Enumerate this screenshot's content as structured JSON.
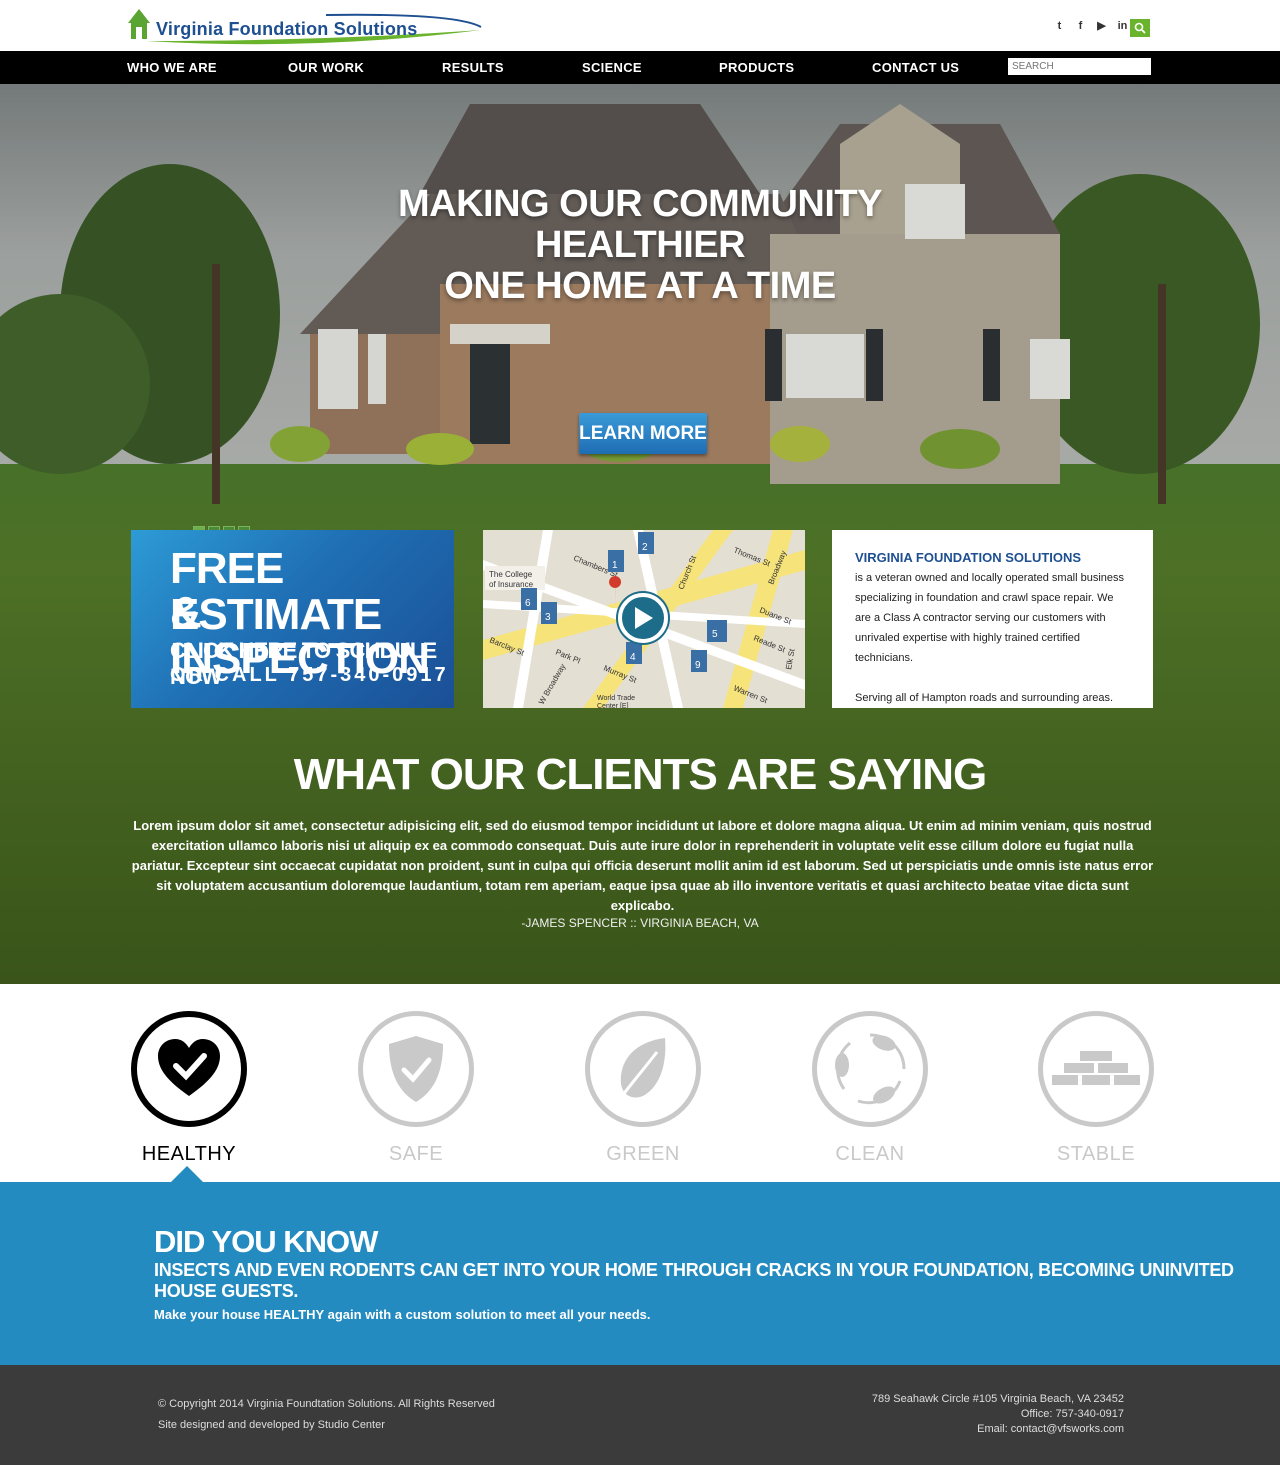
{
  "header": {
    "logo_text": "Virginia Foundation Solutions",
    "social": [
      {
        "icon": "twitter-icon",
        "glyph": "t"
      },
      {
        "icon": "facebook-icon",
        "glyph": "f"
      },
      {
        "icon": "youtube-icon",
        "glyph": "▶"
      },
      {
        "icon": "linkedin-icon",
        "glyph": "in"
      },
      {
        "icon": "rss-icon",
        "glyph": "◗"
      }
    ]
  },
  "nav": {
    "items": [
      "WHO WE ARE",
      "OUR WORK",
      "RESULTS",
      "SCIENCE",
      "PRODUCTS",
      "CONTACT US"
    ],
    "search_placeholder": "SEARCH"
  },
  "hero": {
    "title_line1": "MAKING OUR COMMUNITY",
    "title_line2": "HEALTHIER",
    "title_line3": "ONE HOME AT A TIME",
    "cta_label": "LEARN MORE",
    "slides": 4,
    "active_slide": 1
  },
  "estimate": {
    "line1": "FREE ESTIMATE",
    "line2": "& INSPECTION",
    "line3": "CLICK HERE TO SCHDULE NOW",
    "line4": "OR CALL 757-340-0917"
  },
  "map": {
    "streets": [
      "Chambers St",
      "Church St",
      "Thomas St",
      "Broadway",
      "Duane St",
      "Reade St",
      "Barclay St",
      "Park Pl",
      "Murray St",
      "W Broadway",
      "Warren St",
      "Elk St"
    ],
    "labels": [
      "The College of Insurance",
      "World Trade Center [E]"
    ],
    "pins": [
      "1",
      "2",
      "3",
      "4",
      "5",
      "6",
      "9"
    ]
  },
  "about": {
    "title": "VIRGINIA FOUNDATION SOLUTIONS",
    "text": "is a veteran owned and locally operated small business specializing in foundation and crawl space repair. We are a Class A contractor serving our customers with unrivaled expertise with highly trained certified technicians.",
    "serving": "Serving all of Hampton roads and surrounding areas."
  },
  "testimonials": {
    "title": "WHAT OUR CLIENTS ARE SAYING",
    "quote": "Lorem ipsum dolor sit amet, consectetur adipisicing elit, sed do eiusmod tempor incididunt ut labore et dolore magna aliqua. Ut enim ad minim veniam, quis nostrud exercitation ullamco laboris nisi ut aliquip ex ea commodo consequat. Duis aute irure dolor in reprehenderit in voluptate velit esse cillum dolore eu fugiat nulla pariatur. Excepteur sint occaecat cupidatat non proident, sunt in culpa qui officia deserunt mollit anim id est laborum. Sed ut perspiciatis unde omnis iste natus error sit voluptatem accusantium doloremque laudantium, totam rem aperiam, eaque ipsa quae ab illo inventore veritatis et quasi architecto beatae vitae dicta sunt explicabo.",
    "author": "-JAMES SPENCER :: VIRGINIA BEACH, VA"
  },
  "features": [
    {
      "label": "HEALTHY",
      "icon": "heart-check-icon",
      "active": true
    },
    {
      "label": "SAFE",
      "icon": "shield-check-icon",
      "active": false
    },
    {
      "label": "GREEN",
      "icon": "leaf-icon",
      "active": false
    },
    {
      "label": "CLEAN",
      "icon": "recycle-leaves-icon",
      "active": false
    },
    {
      "label": "STABLE",
      "icon": "bricks-icon",
      "active": false
    }
  ],
  "did_you_know": {
    "title": "DID YOU KNOW",
    "subtitle": "INSECTS AND EVEN RODENTS CAN GET INTO YOUR HOME THROUGH CRACKS IN YOUR FOUNDATION, BECOMING UNINVITED HOUSE GUESTS.",
    "text": "Make your house HEALTHY again with a custom solution to meet all your needs."
  },
  "footer": {
    "copyright": "© Copyright 2014 Virginia Foundtation Solutions. All Rights Reserved",
    "credit": "Site designed and developed by Studio Center",
    "address": "789 Seahawk Circle #105  Virginia Beach, VA 23452",
    "office": "Office: 757-340-0917",
    "email": "Email: contact@vfsworks.com"
  },
  "colors": {
    "brand_blue": "#1d4f91",
    "accent_green": "#6ab42d",
    "section_blue": "#238bc0",
    "footer_gray": "#3b3b3b"
  }
}
